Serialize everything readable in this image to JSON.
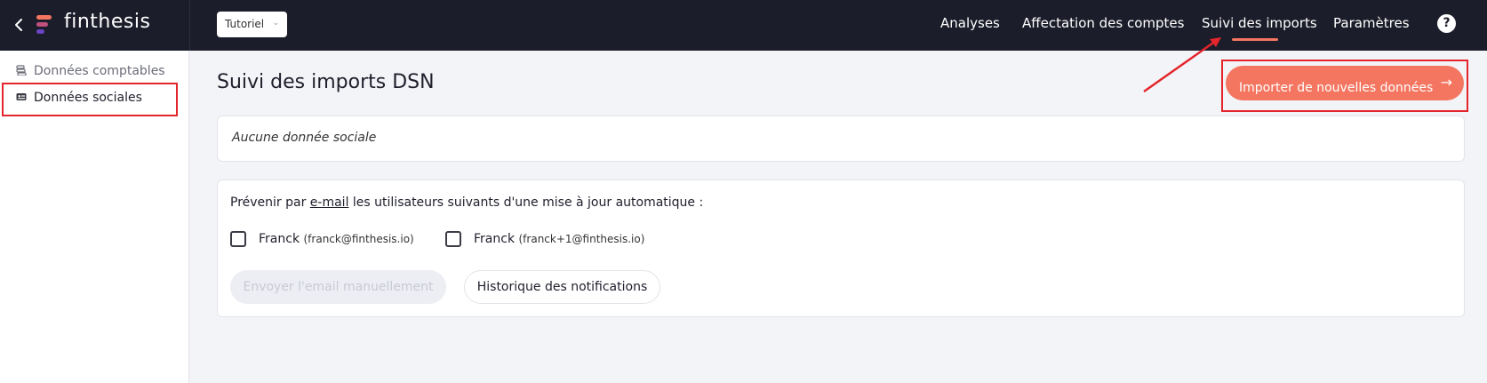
{
  "header": {
    "app_name": "finthesis",
    "workspace": "Tutoriel",
    "nav": [
      {
        "label": "Analyses"
      },
      {
        "label": "Affectation des comptes"
      },
      {
        "label": "Suivi des imports"
      },
      {
        "label": "Paramètres"
      }
    ],
    "help_label": "?",
    "back_icon": "chevron-left-icon",
    "accent_color": "#f47660"
  },
  "sidebar": {
    "items": [
      {
        "label": "Données comptables",
        "icon": "stack-icon"
      },
      {
        "label": "Données sociales",
        "icon": "id-card-icon"
      }
    ]
  },
  "main": {
    "title": "Suivi des imports DSN",
    "import_button": "Importer de nouvelles données",
    "empty_message": "Aucune donnée sociale",
    "notify": {
      "prefix": "Prévenir par ",
      "link": "e-mail",
      "suffix": " les utilisateurs suivants d'une mise à jour automatique :",
      "users": [
        {
          "name": "Franck",
          "email": "(franck@finthesis.io)"
        },
        {
          "name": "Franck",
          "email": "(franck+1@finthesis.io)"
        }
      ],
      "send_button": "Envoyer l'email manuellement",
      "history_button": "Historique des notifications"
    }
  },
  "annotation": {
    "highlight_color": "#e4252b"
  }
}
